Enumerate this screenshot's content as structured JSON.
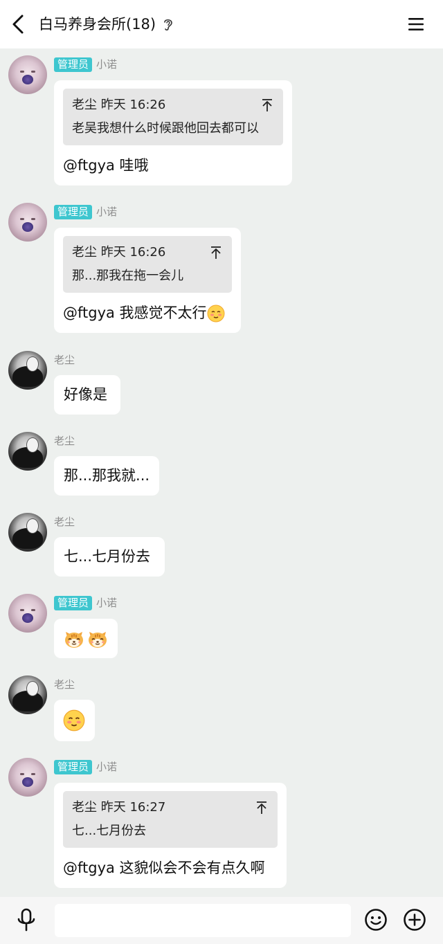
{
  "header": {
    "back_icon": "chevron-left-icon",
    "title": "白马养身会所(18)",
    "ear_icon": "ear-icon",
    "menu_icon": "hamburger-menu-icon"
  },
  "messages": [
    {
      "badge": "管理员",
      "sender": "小诺",
      "quote_head": "老尘 昨天 16:26",
      "quote_text": "老吴我想什么时候跟他回去都可以",
      "text": "@ftgya 哇哦"
    },
    {
      "badge": "管理员",
      "sender": "小诺",
      "quote_head": "老尘 昨天 16:26",
      "quote_text": "那...那我在拖一会儿",
      "text": "@ftgya 我感觉不太行",
      "emoji": "blush-face-emoji"
    },
    {
      "sender": "老尘",
      "text": "好像是"
    },
    {
      "sender": "老尘",
      "text": "那...那我就..."
    },
    {
      "sender": "老尘",
      "text": "七...七月份去"
    },
    {
      "badge": "管理员",
      "sender": "小诺",
      "emoji": "tiger-face-emoji"
    },
    {
      "sender": "老尘",
      "emoji": "blush-face-emoji"
    },
    {
      "badge": "管理员",
      "sender": "小诺",
      "quote_head": "老尘 昨天 16:27",
      "quote_text": "七...七月份去",
      "text": "@ftgya 这貌似会不会有点久啊"
    }
  ],
  "input_bar": {
    "placeholder": "",
    "mic_icon": "microphone-icon",
    "emoji_icon": "smiley-icon",
    "plus_icon": "plus-circle-icon"
  }
}
